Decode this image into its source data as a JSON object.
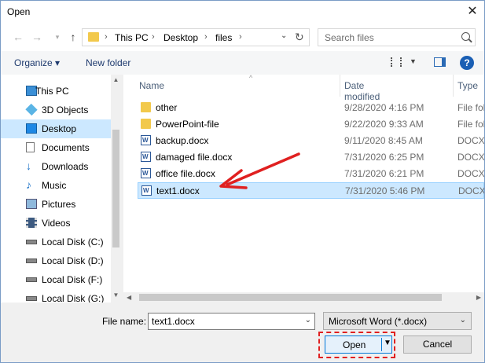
{
  "window": {
    "title": "Open"
  },
  "address": {
    "crumbs": [
      "This PC",
      "Desktop",
      "files"
    ]
  },
  "search": {
    "placeholder": "Search files"
  },
  "toolbar": {
    "organize": "Organize ▾",
    "new_folder": "New folder"
  },
  "nav": {
    "items": [
      {
        "label": "This PC",
        "icon": "computer-icon"
      },
      {
        "label": "3D Objects",
        "icon": "cube-icon"
      },
      {
        "label": "Desktop",
        "icon": "desktop-icon",
        "selected": true
      },
      {
        "label": "Documents",
        "icon": "documents-icon"
      },
      {
        "label": "Downloads",
        "icon": "download-arrow-icon"
      },
      {
        "label": "Music",
        "icon": "music-note-icon"
      },
      {
        "label": "Pictures",
        "icon": "pictures-icon"
      },
      {
        "label": "Videos",
        "icon": "film-icon"
      },
      {
        "label": "Local Disk (C:)",
        "icon": "drive-icon"
      },
      {
        "label": "Local Disk (D:)",
        "icon": "drive-icon"
      },
      {
        "label": "Local Disk (F:)",
        "icon": "drive-icon"
      },
      {
        "label": "Local Disk (G:)",
        "icon": "drive-icon"
      }
    ]
  },
  "files": {
    "headers": {
      "name": "Name",
      "date": "Date modified",
      "type": "Type"
    },
    "rows": [
      {
        "name": "other",
        "date": "9/28/2020 4:16 PM",
        "type": "File fol",
        "kind": "folder"
      },
      {
        "name": "PowerPoint-file",
        "date": "9/22/2020 9:33 AM",
        "type": "File fol",
        "kind": "folder"
      },
      {
        "name": "backup.docx",
        "date": "9/11/2020 8:45 AM",
        "type": "DOCX",
        "kind": "docx"
      },
      {
        "name": "damaged file.docx",
        "date": "7/31/2020 6:25 PM",
        "type": "DOCX",
        "kind": "docx"
      },
      {
        "name": "office file.docx",
        "date": "7/31/2020 6:21 PM",
        "type": "DOCX",
        "kind": "docx"
      },
      {
        "name": "text1.docx",
        "date": "7/31/2020 5:46 PM",
        "type": "DOCX",
        "kind": "docx",
        "selected": true
      }
    ]
  },
  "bottom": {
    "file_name_label": "File name:",
    "file_name_value": "text1.docx",
    "file_type": "Microsoft Word (*.docx)",
    "open_label": "Open",
    "cancel_label": "Cancel"
  },
  "colors": {
    "selection": "#cce8ff",
    "annotation": "#e02020",
    "accent": "#0078d7"
  }
}
